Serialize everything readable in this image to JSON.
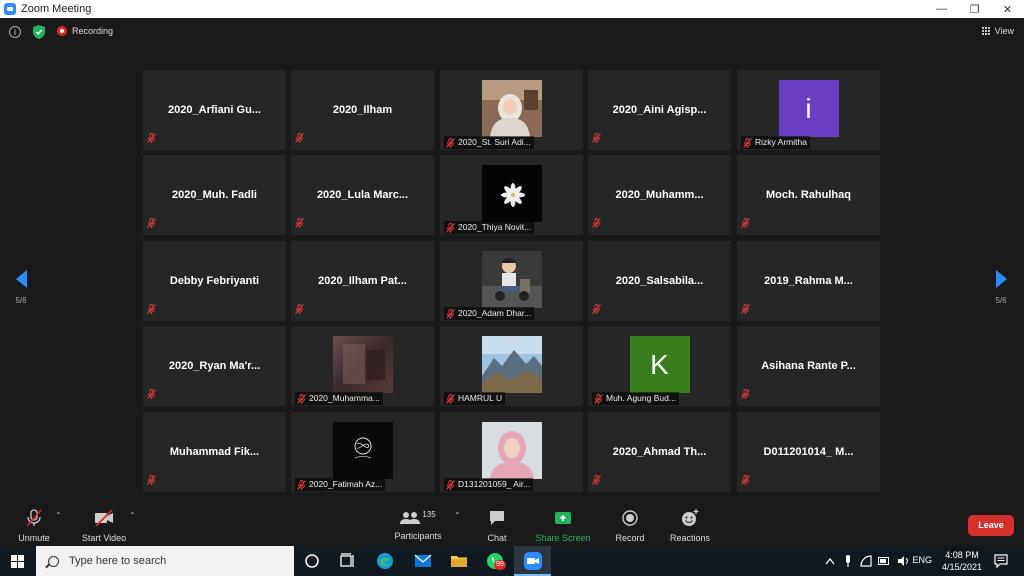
{
  "window": {
    "title": "Zoom Meeting",
    "minimize": "—",
    "restore": "❐",
    "close": "✕"
  },
  "topbar": {
    "recording_label": "Recording",
    "view_label": "View",
    "info_glyph": "i"
  },
  "navigation": {
    "page_left": "5/6",
    "page_right": "5/6"
  },
  "tiles": [
    {
      "name": "2020_Arfiani Gu...",
      "type": "name"
    },
    {
      "name": "2020_Ilham",
      "type": "name"
    },
    {
      "name": "2020_St. Suri Adi...",
      "type": "photo",
      "photo": "portrait-hijab-cafe"
    },
    {
      "name": "2020_Aini Agisp...",
      "type": "name"
    },
    {
      "name": "Rizky Armitha",
      "type": "avatar",
      "letter": "i",
      "color": "#6a3ec2"
    },
    {
      "name": "2020_Muh. Fadli",
      "type": "name"
    },
    {
      "name": "2020_Lula Marc...",
      "type": "name"
    },
    {
      "name": "2020_Thiya Novit...",
      "type": "photo",
      "photo": "white-flower-black"
    },
    {
      "name": "2020_Muhamm...",
      "type": "name"
    },
    {
      "name": "Moch. Rahulhaq",
      "type": "name"
    },
    {
      "name": "Debby Febriyanti",
      "type": "name"
    },
    {
      "name": "2020_Ilham Pat...",
      "type": "name"
    },
    {
      "name": "2020_Adam Dhar...",
      "type": "photo",
      "photo": "cartoon-sitting"
    },
    {
      "name": "2020_Salsabila...",
      "type": "name"
    },
    {
      "name": "2019_Rahma M...",
      "type": "name"
    },
    {
      "name": "2020_Ryan Ma'r...",
      "type": "name"
    },
    {
      "name": "2020_Muhamma...",
      "type": "photo",
      "photo": "blurred-dark"
    },
    {
      "name": "HAMRUL U",
      "type": "photo",
      "photo": "mountain-landscape"
    },
    {
      "name": "Muh. Agung Bud...",
      "type": "avatar",
      "letter": "K",
      "color": "#3a7d1e"
    },
    {
      "name": "Asihana Rante P...",
      "type": "name"
    },
    {
      "name": "Muhammad  Fik...",
      "type": "name"
    },
    {
      "name": "2020_Fatimah Az...",
      "type": "photo",
      "photo": "white-scribble-black"
    },
    {
      "name": "D131201059_ Air...",
      "type": "photo",
      "photo": "portrait-hijab-pink"
    },
    {
      "name": "2020_Ahmad Th...",
      "type": "name"
    },
    {
      "name": "D011201014_ M...",
      "type": "name"
    }
  ],
  "toolbar": {
    "unmute": "Unmute",
    "start_video": "Start Video",
    "participants": "Participants",
    "participants_count": "135",
    "chat": "Chat",
    "share_screen": "Share Screen",
    "record": "Record",
    "reactions": "Reactions",
    "leave": "Leave",
    "accent": "#2d8cff",
    "share_color": "#23b45a",
    "leave_color": "#d4302c"
  },
  "taskbar": {
    "search_placeholder": "Type here to search",
    "language": "ENG",
    "time": "4:08 PM",
    "date": "4/15/2021",
    "whatsapp_badge": "99"
  }
}
